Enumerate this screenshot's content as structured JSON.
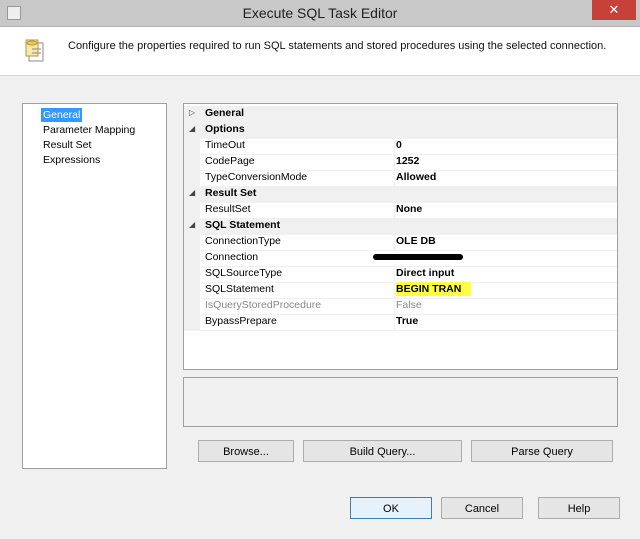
{
  "window": {
    "title": "Execute SQL Task Editor",
    "close_glyph": "✕"
  },
  "header": {
    "description": "Configure the properties required to run SQL statements and stored procedures using the selected connection."
  },
  "nav": {
    "items": [
      "General",
      "Parameter Mapping",
      "Result Set",
      "Expressions"
    ],
    "selected": "General"
  },
  "grid": {
    "categories": {
      "general": "General",
      "options": "Options",
      "result_set": "Result Set",
      "sql_statement": "SQL Statement"
    },
    "props": {
      "timeout": {
        "name": "TimeOut",
        "value": "0"
      },
      "codepage": {
        "name": "CodePage",
        "value": "1252"
      },
      "typeconversion": {
        "name": "TypeConversionMode",
        "value": "Allowed"
      },
      "resultset": {
        "name": "ResultSet",
        "value": "None"
      },
      "connectiontype": {
        "name": "ConnectionType",
        "value": "OLE DB"
      },
      "connection": {
        "name": "Connection",
        "value": ""
      },
      "sqlsourcetype": {
        "name": "SQLSourceType",
        "value": "Direct input"
      },
      "sqlstatement": {
        "name": "SQLStatement",
        "value": "BEGIN TRAN"
      },
      "isquerystored": {
        "name": "IsQueryStoredProcedure",
        "value": "False"
      },
      "bypassprepare": {
        "name": "BypassPrepare",
        "value": "True"
      }
    }
  },
  "buttons": {
    "browse": "Browse...",
    "build_query": "Build Query...",
    "parse_query": "Parse Query",
    "ok": "OK",
    "cancel": "Cancel",
    "help": "Help"
  },
  "colors": {
    "selection": "#3399ff",
    "highlight": "#ffff44",
    "close": "#c7413b"
  }
}
